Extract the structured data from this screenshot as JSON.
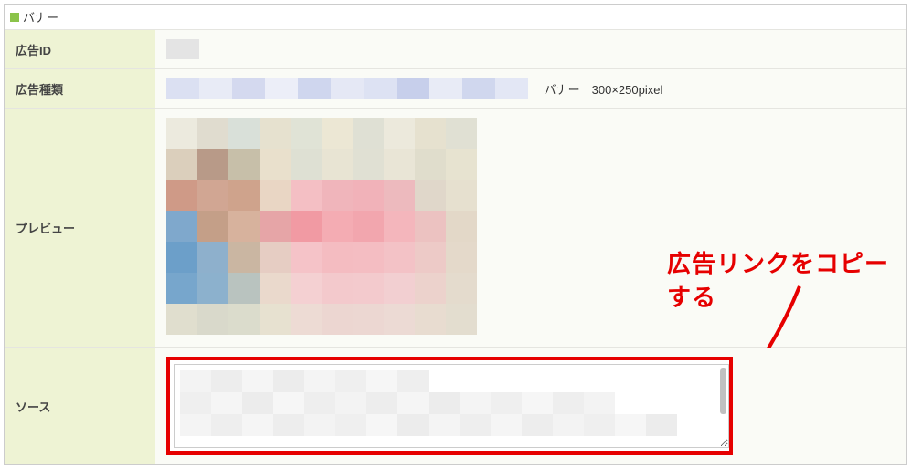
{
  "section": {
    "title": "バナー"
  },
  "rows": {
    "ad_id": {
      "label": "広告ID",
      "value": ""
    },
    "ad_type": {
      "label": "広告種類",
      "banner_text": "バナー　300×250pixel"
    },
    "preview": {
      "label": "プレビュー"
    },
    "source": {
      "label": "ソース",
      "value": ""
    }
  },
  "callout": {
    "text": "広告リンクをコピーする"
  },
  "colors": {
    "accent_green": "#8bc34a",
    "highlight_red": "#e60000",
    "label_bg": "#eef3d4",
    "value_bg": "#fafbf6"
  }
}
